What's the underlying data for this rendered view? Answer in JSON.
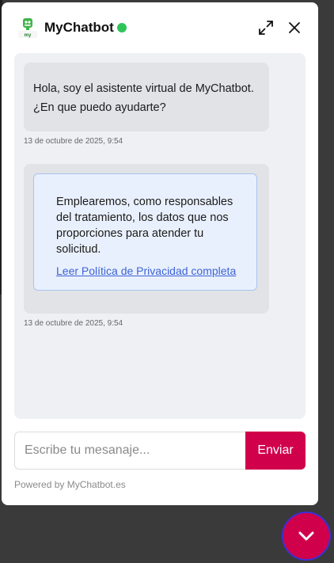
{
  "header": {
    "title": "MyChatbot",
    "logo_text": "my chatbot",
    "status_color": "#2fc45a",
    "expand_icon": "expand-icon",
    "close_icon": "close-icon"
  },
  "messages": [
    {
      "text": "Hola, soy el asistente virtual de MyChatbot. ¿En que puedo ayudarte?",
      "timestamp": "13 de octubre de 2025, 9:54"
    },
    {
      "text": "Emplearemos, como responsables del tratamiento, los datos que nos proporciones para atender tu solicitud.",
      "link_label": "Leer Política de Privacidad completa",
      "timestamp": "13 de octubre de 2025, 9:54"
    }
  ],
  "composer": {
    "placeholder": "Escribe tu mesanaje...",
    "value": "",
    "send_label": "Enviar"
  },
  "footer": {
    "powered_by": "Powered by MyChatbot.es"
  },
  "launcher": {
    "icon": "chevron-down-icon"
  },
  "colors": {
    "accent": "#d1004b",
    "link": "#3c63d6",
    "privacy_card_bg": "#e9f0fd",
    "chat_bg": "#eef0f3",
    "bubble_bg": "#e1e3e7"
  }
}
